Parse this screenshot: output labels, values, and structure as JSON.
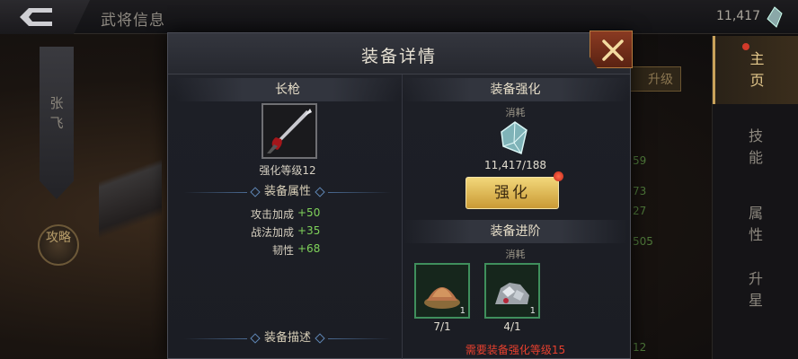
{
  "header": {
    "title": "武将信息",
    "currency_value": "11,417"
  },
  "hero": {
    "name": "张飞",
    "strategy_label": "攻略"
  },
  "side_tabs": [
    {
      "label": "主页",
      "active": true
    },
    {
      "label": "技能",
      "active": false
    },
    {
      "label": "属性",
      "active": false
    },
    {
      "label": "升星",
      "active": false
    }
  ],
  "background": {
    "upgrade_button": "升级",
    "numbers": [
      "59",
      "73",
      "27",
      "505",
      "12"
    ]
  },
  "dialog": {
    "title": "装备详情",
    "left": {
      "item_name": "长枪",
      "enhance_level": "强化等级12",
      "attributes_title": "装备属性",
      "attributes": [
        {
          "name": "攻击加成",
          "value": "+50"
        },
        {
          "name": "战法加成",
          "value": "+35"
        },
        {
          "name": "韧性",
          "value": "+68"
        }
      ],
      "description_title": "装备描述"
    },
    "right": {
      "enhance_title": "装备强化",
      "enhance_consume_label": "消耗",
      "enhance_cost": "11,417/188",
      "enhance_button": "强化",
      "advance_title": "装备进阶",
      "advance_consume_label": "消耗",
      "materials": [
        {
          "icon": "grain-pile-icon",
          "badge": "1",
          "count": "7/1"
        },
        {
          "icon": "ore-pile-icon",
          "badge": "1",
          "count": "4/1"
        }
      ],
      "requirement": "需要装备强化等级15"
    }
  },
  "colors": {
    "accent_gold": "#c9a25a",
    "stat_green": "#7fd25a",
    "warning_red": "#e8402e",
    "material_border": "#3f8f5c"
  }
}
